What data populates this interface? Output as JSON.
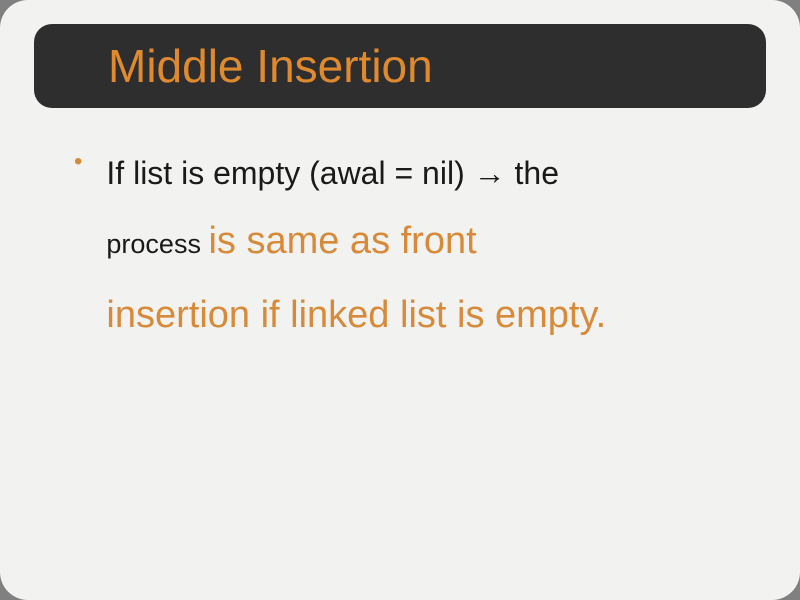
{
  "title": "Middle Insertion",
  "bullet": {
    "lead": "If list is empty (awal = nil) ",
    "arrow": "→",
    "after_arrow": " the",
    "process_word": "process ",
    "highlight_part1": "is same as front",
    "highlight_part2": "insertion if linked list is empty",
    "period": "."
  },
  "colors": {
    "accent": "#e08a2f",
    "highlight": "#d68a3a",
    "title_bg": "#2e2e2e",
    "slide_bg": "#f2f2f0"
  }
}
